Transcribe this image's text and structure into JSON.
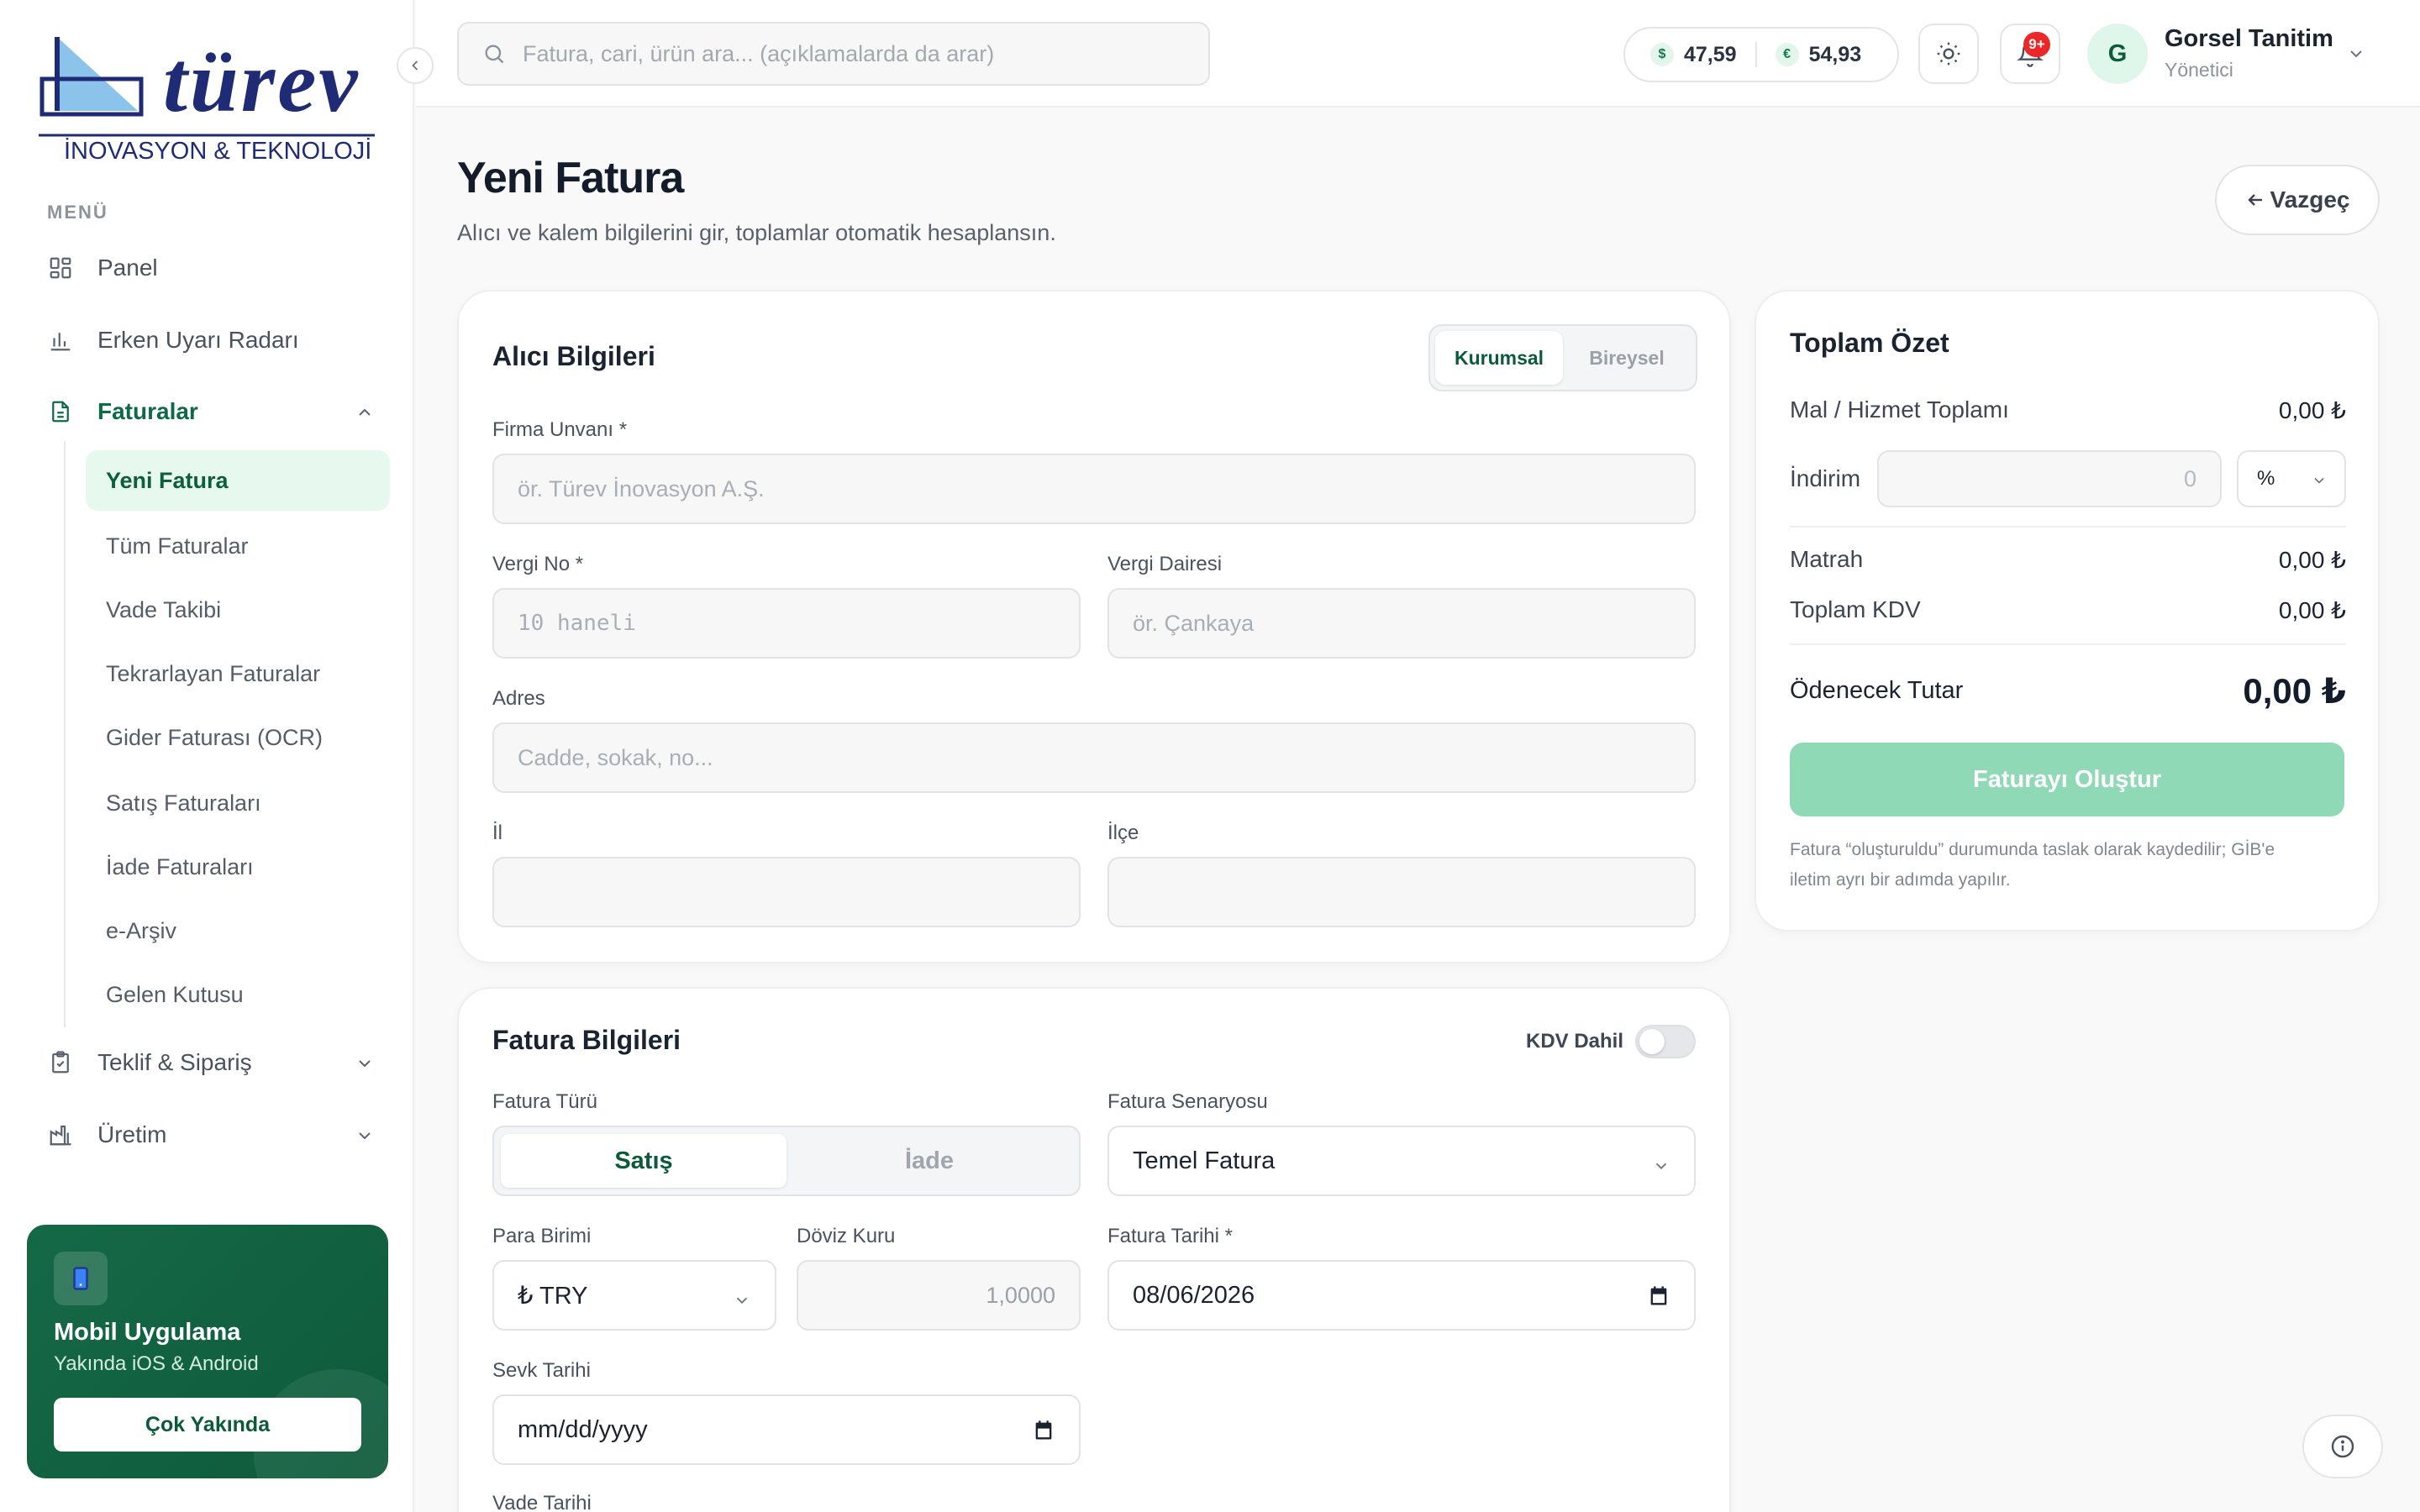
{
  "brand": {
    "name": "türev",
    "tagline": "İNOVASYON & TEKNOLOJİ",
    "color": "#1f2c75"
  },
  "sidebar": {
    "menu_label": "MENÜ",
    "items": [
      {
        "label": "Panel",
        "icon": "grid-icon"
      },
      {
        "label": "Erken Uyarı Radarı",
        "icon": "bar-chart-icon"
      },
      {
        "label": "Faturalar",
        "icon": "document-icon",
        "active": true,
        "expanded": true
      },
      {
        "label": "Teklif & Sipariş",
        "icon": "clipboard-check-icon"
      },
      {
        "label": "Üretim",
        "icon": "factory-icon"
      }
    ],
    "sub_items": [
      {
        "label": "Yeni Fatura",
        "active": true
      },
      {
        "label": "Tüm Faturalar"
      },
      {
        "label": "Vade Takibi"
      },
      {
        "label": "Tekrarlayan Faturalar"
      },
      {
        "label": "Gider Faturası (OCR)"
      },
      {
        "label": "Satış Faturaları"
      },
      {
        "label": "İade Faturaları"
      },
      {
        "label": "e-Arşiv"
      },
      {
        "label": "Gelen Kutusu"
      }
    ],
    "promo": {
      "title": "Mobil Uygulama",
      "subtitle": "Yakında iOS & Android",
      "button": "Çok Yakında"
    }
  },
  "header": {
    "search_placeholder": "Fatura, cari, ürün ara... (açıklamalarda da arar)",
    "usd_symbol": "$",
    "usd_rate": "47,59",
    "eur_symbol": "€",
    "eur_rate": "54,93",
    "notification_badge": "9+",
    "user_initial": "G",
    "user_name": "Gorsel Tanitim",
    "user_role": "Yönetici"
  },
  "page": {
    "title": "Yeni Fatura",
    "subtitle": "Alıcı ve kalem bilgilerini gir, toplamlar otomatik hesaplansın.",
    "cancel_label": "Vazgeç"
  },
  "buyer": {
    "title": "Alıcı Bilgileri",
    "segments": [
      "Kurumsal",
      "Bireysel"
    ],
    "company_label": "Firma Unvanı *",
    "company_placeholder": "ör. Türev İnovasyon A.Ş.",
    "tax_no_label": "Vergi No *",
    "tax_no_placeholder": "10 haneli",
    "tax_office_label": "Vergi Dairesi",
    "tax_office_placeholder": "ör. Çankaya",
    "address_label": "Adres",
    "address_placeholder": "Cadde, sokak, no...",
    "city_label": "İl",
    "district_label": "İlçe"
  },
  "invoice": {
    "title": "Fatura Bilgileri",
    "vat_included_label": "KDV Dahil",
    "type_label": "Fatura Türü",
    "types": [
      "Satış",
      "İade"
    ],
    "scenario_label": "Fatura Senaryosu",
    "scenario_value": "Temel Fatura",
    "currency_label": "Para Birimi",
    "currency_value": "₺ TRY",
    "exchange_label": "Döviz Kuru",
    "exchange_value": "1,0000",
    "date_label": "Fatura Tarihi *",
    "date_value": "08/06/2026",
    "ship_label": "Sevk Tarihi",
    "ship_value": "mm/dd/yyyy",
    "due_label": "Vade Tarihi"
  },
  "summary": {
    "title": "Toplam Özet",
    "goods_label": "Mal / Hizmet Toplamı",
    "goods_value": "0,00 ₺",
    "discount_label": "İndirim",
    "discount_value": "0",
    "discount_unit": "%",
    "base_label": "Matrah",
    "base_value": "0,00 ₺",
    "vat_label": "Toplam KDV",
    "vat_value": "0,00 ₺",
    "payable_label": "Ödenecek Tutar",
    "payable_value": "0,00 ₺",
    "create_label": "Faturayı Oluştur",
    "note": "Fatura “oluşturuldu” durumunda taslak olarak kaydedilir; GİB'e iletim ayrı bir adımda yapılır."
  },
  "colors": {
    "accent": "#0e6a46",
    "active_bg": "#e7f8ef",
    "button_disabled": "#8fd9b6",
    "badge": "#ec2727"
  }
}
